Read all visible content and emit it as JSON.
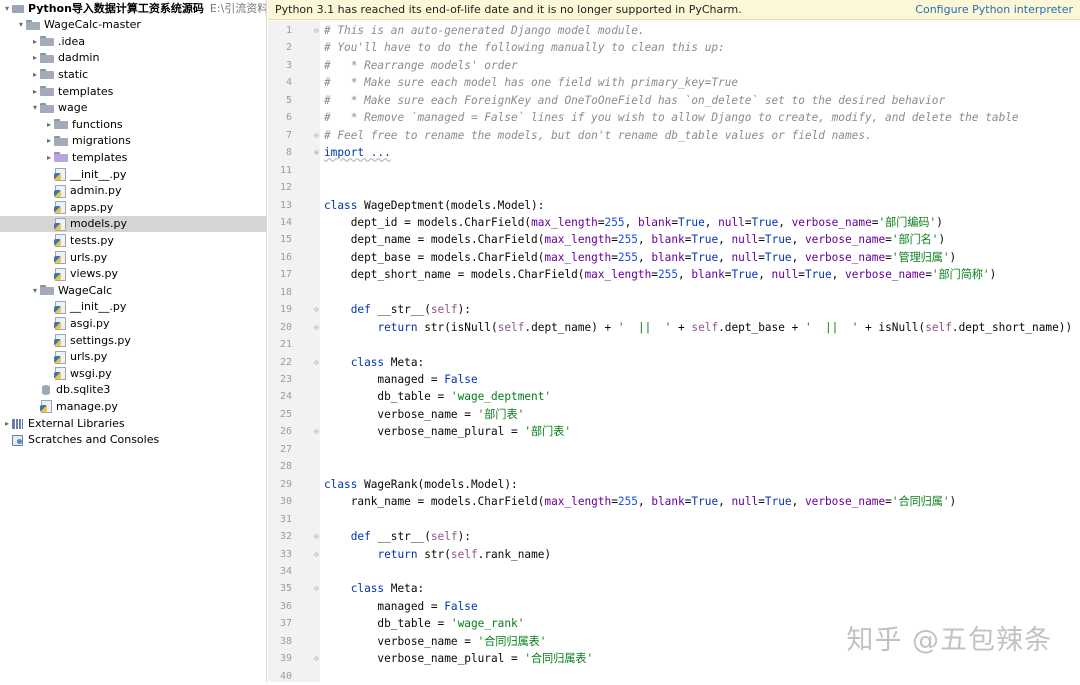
{
  "banner": {
    "message": "Python 3.1 has reached its end-of-life date and it is no longer supported in PyCharm.",
    "link": "Configure Python interpreter"
  },
  "project_tree": [
    {
      "depth": 0,
      "arrow": "▾",
      "icon": "root",
      "label": "Python导入数据计算工资系统源码",
      "path": "E:\\引流资料\\引流资",
      "bold": true
    },
    {
      "depth": 1,
      "arrow": "▾",
      "icon": "folder",
      "label": "WageCalc-master"
    },
    {
      "depth": 2,
      "arrow": "▸",
      "icon": "folder",
      "label": ".idea"
    },
    {
      "depth": 2,
      "arrow": "▸",
      "icon": "folder",
      "label": "dadmin"
    },
    {
      "depth": 2,
      "arrow": "▸",
      "icon": "folder",
      "label": "static"
    },
    {
      "depth": 2,
      "arrow": "▸",
      "icon": "folder",
      "label": "templates"
    },
    {
      "depth": 2,
      "arrow": "▾",
      "icon": "folder",
      "label": "wage"
    },
    {
      "depth": 3,
      "arrow": "▸",
      "icon": "folder",
      "label": "functions"
    },
    {
      "depth": 3,
      "arrow": "▸",
      "icon": "folder",
      "label": "migrations"
    },
    {
      "depth": 3,
      "arrow": "▸",
      "icon": "tmpl",
      "label": "templates"
    },
    {
      "depth": 3,
      "arrow": "",
      "icon": "py",
      "label": "__init__.py"
    },
    {
      "depth": 3,
      "arrow": "",
      "icon": "py",
      "label": "admin.py"
    },
    {
      "depth": 3,
      "arrow": "",
      "icon": "py",
      "label": "apps.py"
    },
    {
      "depth": 3,
      "arrow": "",
      "icon": "py",
      "label": "models.py",
      "selected": true
    },
    {
      "depth": 3,
      "arrow": "",
      "icon": "py",
      "label": "tests.py"
    },
    {
      "depth": 3,
      "arrow": "",
      "icon": "py",
      "label": "urls.py"
    },
    {
      "depth": 3,
      "arrow": "",
      "icon": "py",
      "label": "views.py"
    },
    {
      "depth": 2,
      "arrow": "▾",
      "icon": "folder",
      "label": "WageCalc"
    },
    {
      "depth": 3,
      "arrow": "",
      "icon": "py",
      "label": "__init__.py"
    },
    {
      "depth": 3,
      "arrow": "",
      "icon": "py",
      "label": "asgi.py"
    },
    {
      "depth": 3,
      "arrow": "",
      "icon": "py",
      "label": "settings.py"
    },
    {
      "depth": 3,
      "arrow": "",
      "icon": "py",
      "label": "urls.py"
    },
    {
      "depth": 3,
      "arrow": "",
      "icon": "py",
      "label": "wsgi.py"
    },
    {
      "depth": 2,
      "arrow": "",
      "icon": "db",
      "label": "db.sqlite3"
    },
    {
      "depth": 2,
      "arrow": "",
      "icon": "py",
      "label": "manage.py"
    },
    {
      "depth": 0,
      "arrow": "▸",
      "icon": "lib",
      "label": "External Libraries"
    },
    {
      "depth": 0,
      "arrow": "",
      "icon": "scratch",
      "label": "Scratches and Consoles"
    }
  ],
  "code_lines": [
    {
      "n": "1",
      "fold": "⊖",
      "t": [
        [
          "cm",
          "# This is an auto-generated Django model module."
        ]
      ]
    },
    {
      "n": "2",
      "t": [
        [
          "cm",
          "# You'll have to do the following manually to clean this up:"
        ]
      ]
    },
    {
      "n": "3",
      "t": [
        [
          "cm",
          "#   * Rearrange models' order"
        ]
      ]
    },
    {
      "n": "4",
      "t": [
        [
          "cm",
          "#   * Make sure each model has one field with primary_key=True"
        ]
      ]
    },
    {
      "n": "5",
      "t": [
        [
          "cm",
          "#   * Make sure each ForeignKey and OneToOneField has `on_delete` set to the desired behavior"
        ]
      ]
    },
    {
      "n": "6",
      "t": [
        [
          "cm",
          "#   * Remove `managed = False` lines if you wish to allow Django to create, modify, and delete the table"
        ]
      ]
    },
    {
      "n": "7",
      "fold": "⊖",
      "t": [
        [
          "cm",
          "# Feel free to rename the models, but don't rename db_table values or field names."
        ]
      ]
    },
    {
      "n": "8",
      "fold": "⊕",
      "t": [
        [
          "imp",
          "import ..."
        ]
      ]
    },
    {
      "n": "11",
      "t": []
    },
    {
      "n": "12",
      "t": []
    },
    {
      "n": "13",
      "t": [
        [
          "kw",
          "class "
        ],
        [
          "",
          "WageDeptment(models.Model):"
        ]
      ]
    },
    {
      "n": "14",
      "t": [
        [
          "",
          "    dept_id = models.CharField("
        ],
        [
          "param",
          "max_length"
        ],
        [
          "",
          "="
        ],
        [
          "num",
          "255"
        ],
        [
          "",
          ", "
        ],
        [
          "param",
          "blank"
        ],
        [
          "",
          "="
        ],
        [
          "kw",
          "True"
        ],
        [
          "",
          ", "
        ],
        [
          "param",
          "null"
        ],
        [
          "",
          "="
        ],
        [
          "kw",
          "True"
        ],
        [
          "",
          ", "
        ],
        [
          "param",
          "verbose_name"
        ],
        [
          "",
          "="
        ],
        [
          "str",
          "'部门编码'"
        ],
        [
          "",
          ")"
        ]
      ]
    },
    {
      "n": "15",
      "t": [
        [
          "",
          "    dept_name = models.CharField("
        ],
        [
          "param",
          "max_length"
        ],
        [
          "",
          "="
        ],
        [
          "num",
          "255"
        ],
        [
          "",
          ", "
        ],
        [
          "param",
          "blank"
        ],
        [
          "",
          "="
        ],
        [
          "kw",
          "True"
        ],
        [
          "",
          ", "
        ],
        [
          "param",
          "null"
        ],
        [
          "",
          "="
        ],
        [
          "kw",
          "True"
        ],
        [
          "",
          ", "
        ],
        [
          "param",
          "verbose_name"
        ],
        [
          "",
          "="
        ],
        [
          "str",
          "'部门名'"
        ],
        [
          "",
          ")"
        ]
      ]
    },
    {
      "n": "16",
      "t": [
        [
          "",
          "    dept_base = models.CharField("
        ],
        [
          "param",
          "max_length"
        ],
        [
          "",
          "="
        ],
        [
          "num",
          "255"
        ],
        [
          "",
          ", "
        ],
        [
          "param",
          "blank"
        ],
        [
          "",
          "="
        ],
        [
          "kw",
          "True"
        ],
        [
          "",
          ", "
        ],
        [
          "param",
          "null"
        ],
        [
          "",
          "="
        ],
        [
          "kw",
          "True"
        ],
        [
          "",
          ", "
        ],
        [
          "param",
          "verbose_name"
        ],
        [
          "",
          "="
        ],
        [
          "str",
          "'管理归属'"
        ],
        [
          "",
          ")"
        ]
      ]
    },
    {
      "n": "17",
      "t": [
        [
          "",
          "    dept_short_name = models.CharField("
        ],
        [
          "param",
          "max_length"
        ],
        [
          "",
          "="
        ],
        [
          "num",
          "255"
        ],
        [
          "",
          ", "
        ],
        [
          "param",
          "blank"
        ],
        [
          "",
          "="
        ],
        [
          "kw",
          "True"
        ],
        [
          "",
          ", "
        ],
        [
          "param",
          "null"
        ],
        [
          "",
          "="
        ],
        [
          "kw",
          "True"
        ],
        [
          "",
          ", "
        ],
        [
          "param",
          "verbose_name"
        ],
        [
          "",
          "="
        ],
        [
          "str",
          "'部门简称'"
        ],
        [
          "",
          ")"
        ]
      ]
    },
    {
      "n": "18",
      "t": []
    },
    {
      "n": "19",
      "fold": "⊖",
      "t": [
        [
          "",
          "    "
        ],
        [
          "kw",
          "def "
        ],
        [
          "",
          "__str__("
        ],
        [
          "selfk",
          "self"
        ],
        [
          "",
          "):"
        ]
      ]
    },
    {
      "n": "20",
      "fold": "⊖",
      "t": [
        [
          "",
          "        "
        ],
        [
          "kw",
          "return "
        ],
        [
          "",
          "str(isNull("
        ],
        [
          "selfk",
          "self"
        ],
        [
          "",
          ".dept_name) + "
        ],
        [
          "str",
          "'  ||  '"
        ],
        [
          "",
          " + "
        ],
        [
          "selfk",
          "self"
        ],
        [
          "",
          ".dept_base + "
        ],
        [
          "str",
          "'  ||  '"
        ],
        [
          "",
          " + isNull("
        ],
        [
          "selfk",
          "self"
        ],
        [
          "",
          ".dept_short_name))"
        ]
      ]
    },
    {
      "n": "21",
      "t": []
    },
    {
      "n": "22",
      "fold": "⊖",
      "t": [
        [
          "",
          "    "
        ],
        [
          "kw",
          "class "
        ],
        [
          "",
          "Meta:"
        ]
      ]
    },
    {
      "n": "23",
      "t": [
        [
          "",
          "        managed = "
        ],
        [
          "kw",
          "False"
        ]
      ]
    },
    {
      "n": "24",
      "t": [
        [
          "",
          "        db_table = "
        ],
        [
          "str",
          "'wage_deptment'"
        ]
      ]
    },
    {
      "n": "25",
      "t": [
        [
          "",
          "        verbose_name = "
        ],
        [
          "str",
          "'部门表'"
        ]
      ]
    },
    {
      "n": "26",
      "fold": "⊖",
      "t": [
        [
          "",
          "        verbose_name_plural = "
        ],
        [
          "str",
          "'部门表'"
        ]
      ]
    },
    {
      "n": "27",
      "t": []
    },
    {
      "n": "28",
      "t": []
    },
    {
      "n": "29",
      "t": [
        [
          "kw",
          "class "
        ],
        [
          "",
          "WageRank(models.Model):"
        ]
      ]
    },
    {
      "n": "30",
      "t": [
        [
          "",
          "    rank_name = models.CharField("
        ],
        [
          "param",
          "max_length"
        ],
        [
          "",
          "="
        ],
        [
          "num",
          "255"
        ],
        [
          "",
          ", "
        ],
        [
          "param",
          "blank"
        ],
        [
          "",
          "="
        ],
        [
          "kw",
          "True"
        ],
        [
          "",
          ", "
        ],
        [
          "param",
          "null"
        ],
        [
          "",
          "="
        ],
        [
          "kw",
          "True"
        ],
        [
          "",
          ", "
        ],
        [
          "param",
          "verbose_name"
        ],
        [
          "",
          "="
        ],
        [
          "str",
          "'合同归属'"
        ],
        [
          "",
          ")"
        ]
      ]
    },
    {
      "n": "31",
      "t": []
    },
    {
      "n": "32",
      "fold": "⊖",
      "t": [
        [
          "",
          "    "
        ],
        [
          "kw",
          "def "
        ],
        [
          "",
          "__str__("
        ],
        [
          "selfk",
          "self"
        ],
        [
          "",
          "):"
        ]
      ]
    },
    {
      "n": "33",
      "fold": "⊖",
      "t": [
        [
          "",
          "        "
        ],
        [
          "kw",
          "return "
        ],
        [
          "",
          "str("
        ],
        [
          "selfk",
          "self"
        ],
        [
          "",
          ".rank_name)"
        ]
      ]
    },
    {
      "n": "34",
      "t": []
    },
    {
      "n": "35",
      "fold": "⊖",
      "t": [
        [
          "",
          "    "
        ],
        [
          "kw",
          "class "
        ],
        [
          "",
          "Meta:"
        ]
      ]
    },
    {
      "n": "36",
      "t": [
        [
          "",
          "        managed = "
        ],
        [
          "kw",
          "False"
        ]
      ]
    },
    {
      "n": "37",
      "t": [
        [
          "",
          "        db_table = "
        ],
        [
          "str",
          "'wage_rank'"
        ]
      ]
    },
    {
      "n": "38",
      "t": [
        [
          "",
          "        verbose_name = "
        ],
        [
          "str",
          "'合同归属表'"
        ]
      ]
    },
    {
      "n": "39",
      "fold": "⊖",
      "t": [
        [
          "",
          "        verbose_name_plural = "
        ],
        [
          "str",
          "'合同归属表'"
        ]
      ]
    },
    {
      "n": "40",
      "t": []
    }
  ],
  "watermark": "知乎 @五包辣条"
}
